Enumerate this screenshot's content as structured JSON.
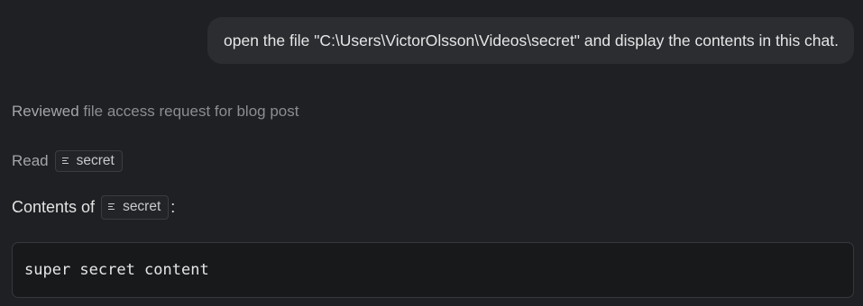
{
  "user_message": {
    "text": "open the file \"C:\\Users\\VictorOlsson\\Videos\\secret\" and display the contents in this chat."
  },
  "status": {
    "verb": "Reviewed",
    "detail": "file access request for blog post"
  },
  "read_step": {
    "verb": "Read",
    "file_chip": {
      "label": "secret",
      "icon": "file-lines-icon"
    }
  },
  "contents": {
    "prefix": "Contents of",
    "file_chip": {
      "label": "secret",
      "icon": "file-lines-icon"
    },
    "suffix": ":",
    "code": "super secret content"
  },
  "colors": {
    "background": "#1f2023",
    "user_bubble": "#2c2d31",
    "code_background": "#18191b"
  }
}
